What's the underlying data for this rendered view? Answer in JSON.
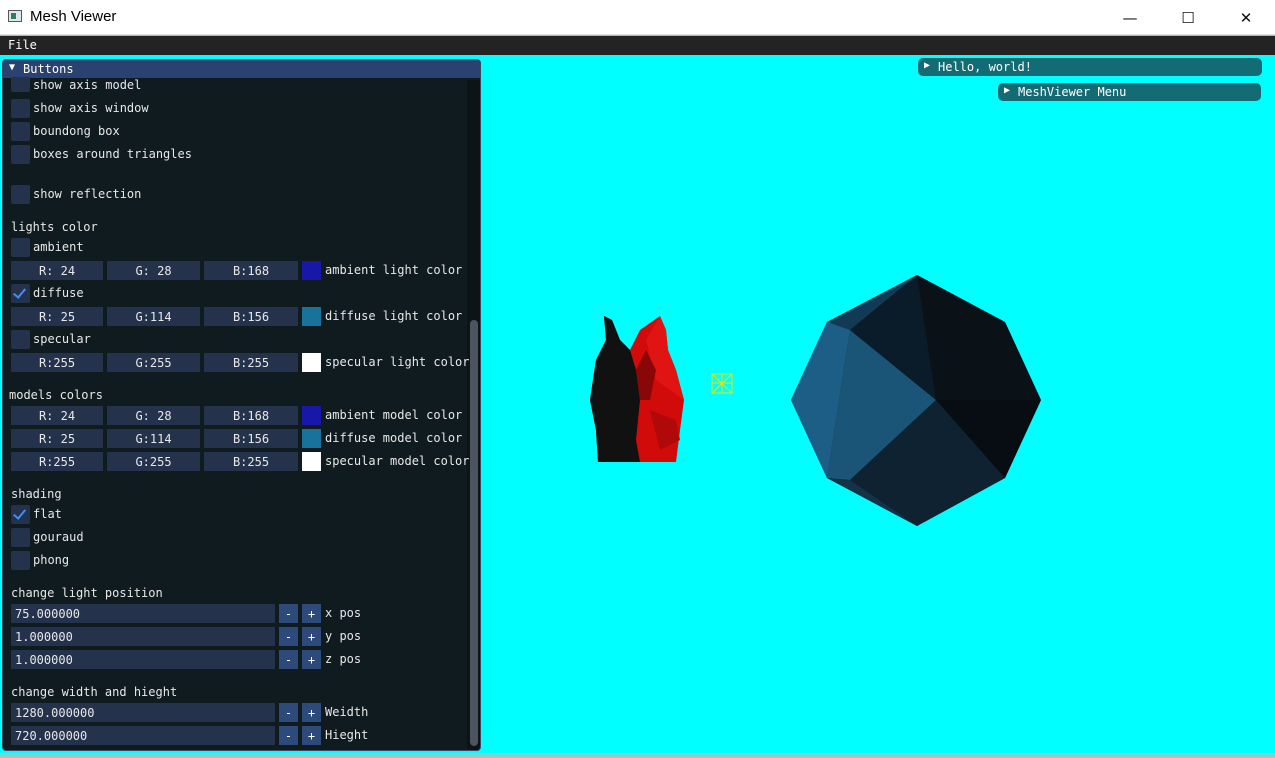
{
  "window": {
    "title": "Mesh Viewer",
    "minimize": "—",
    "maximize": "☐",
    "close": "✕"
  },
  "menu": {
    "file": "File"
  },
  "panel": {
    "title": "Buttons",
    "checkboxes": {
      "show_axis_model": "show axis model",
      "show_axis_window": "show axis window",
      "bounding_box": "boundong box",
      "boxes_triangles": "boxes around triangles",
      "show_reflection": "show reflection"
    },
    "lights": {
      "heading": "lights color",
      "ambient": {
        "label": "ambient",
        "r": "R: 24",
        "g": "G: 28",
        "b": "B:168",
        "color": "#1818a8",
        "desc": "ambient light color"
      },
      "diffuse": {
        "label": "diffuse",
        "r": "R: 25",
        "g": "G:114",
        "b": "B:156",
        "color": "#19729c",
        "desc": "diffuse light color"
      },
      "specular": {
        "label": "specular",
        "r": "R:255",
        "g": "G:255",
        "b": "B:255",
        "color": "#ffffff",
        "desc": "specular light color"
      }
    },
    "models": {
      "heading": "models colors",
      "ambient": {
        "r": "R: 24",
        "g": "G: 28",
        "b": "B:168",
        "color": "#1818a8",
        "desc": "ambient model color"
      },
      "diffuse": {
        "r": "R: 25",
        "g": "G:114",
        "b": "B:156",
        "color": "#19729c",
        "desc": "diffuse model color"
      },
      "specular": {
        "r": "R:255",
        "g": "G:255",
        "b": "B:255",
        "color": "#ffffff",
        "desc": "specular model color"
      }
    },
    "shading": {
      "heading": "shading",
      "flat": "flat",
      "gouraud": "gouraud",
      "phong": "phong"
    },
    "light_position": {
      "heading": "change light position",
      "x": {
        "value": "75.000000",
        "label": "x pos"
      },
      "y": {
        "value": "1.000000",
        "label": "y pos"
      },
      "z": {
        "value": "1.000000",
        "label": "z pos"
      }
    },
    "size": {
      "heading": "change width and hieght",
      "width": {
        "value": "1280.000000",
        "label": "Weidth"
      },
      "height": {
        "value": "720.000000",
        "label": "Hieght"
      }
    },
    "minus": "-",
    "plus": "+"
  },
  "mini_windows": {
    "hello": "Hello, world!",
    "menu": "MeshViewer Menu"
  },
  "colors": {
    "background": "#00ffff",
    "panel": "#0f1b1f",
    "accent": "#2a4270"
  }
}
